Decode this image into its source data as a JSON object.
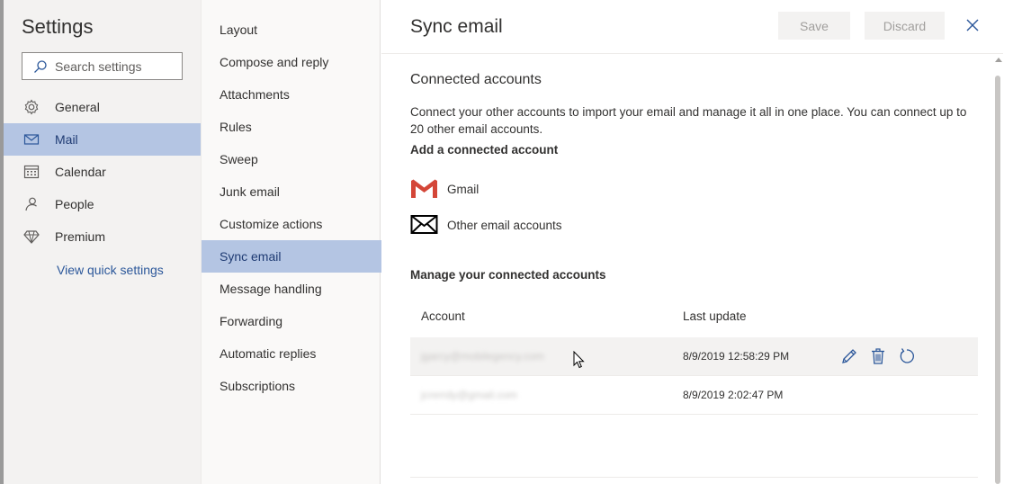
{
  "sidebar": {
    "title": "Settings",
    "search_placeholder": "Search settings",
    "items": [
      {
        "label": "General",
        "icon": "gear-icon"
      },
      {
        "label": "Mail",
        "icon": "mail-icon",
        "selected": true
      },
      {
        "label": "Calendar",
        "icon": "calendar-icon"
      },
      {
        "label": "People",
        "icon": "people-icon"
      },
      {
        "label": "Premium",
        "icon": "diamond-icon"
      }
    ],
    "quick_settings": "View quick settings"
  },
  "subnav": {
    "items": [
      {
        "label": "Layout"
      },
      {
        "label": "Compose and reply"
      },
      {
        "label": "Attachments"
      },
      {
        "label": "Rules"
      },
      {
        "label": "Sweep"
      },
      {
        "label": "Junk email"
      },
      {
        "label": "Customize actions"
      },
      {
        "label": "Sync email",
        "selected": true
      },
      {
        "label": "Message handling"
      },
      {
        "label": "Forwarding"
      },
      {
        "label": "Automatic replies"
      },
      {
        "label": "Subscriptions"
      }
    ]
  },
  "main": {
    "title": "Sync email",
    "save_label": "Save",
    "discard_label": "Discard",
    "connected_title": "Connected accounts",
    "description": "Connect your other accounts to import your email and manage it all in one place. You can connect up to 20 other email accounts.",
    "add_title": "Add a connected account",
    "providers": [
      {
        "label": "Gmail",
        "icon": "gmail-icon"
      },
      {
        "label": "Other email accounts",
        "icon": "envelope-icon"
      }
    ],
    "manage_title": "Manage your connected accounts",
    "table": {
      "headers": {
        "account": "Account",
        "last_update": "Last update"
      },
      "rows": [
        {
          "account": "jgarcy@mobilegency.com",
          "last_update": "8/9/2019 12:58:29 PM"
        },
        {
          "account": "jcrerrdy@gmail.com",
          "last_update": "8/9/2019 2:02:47 PM"
        }
      ]
    }
  },
  "colors": {
    "accent": "#2b579a",
    "selected_bg": "#b4c5e3",
    "gmail_red": "#d44638"
  }
}
